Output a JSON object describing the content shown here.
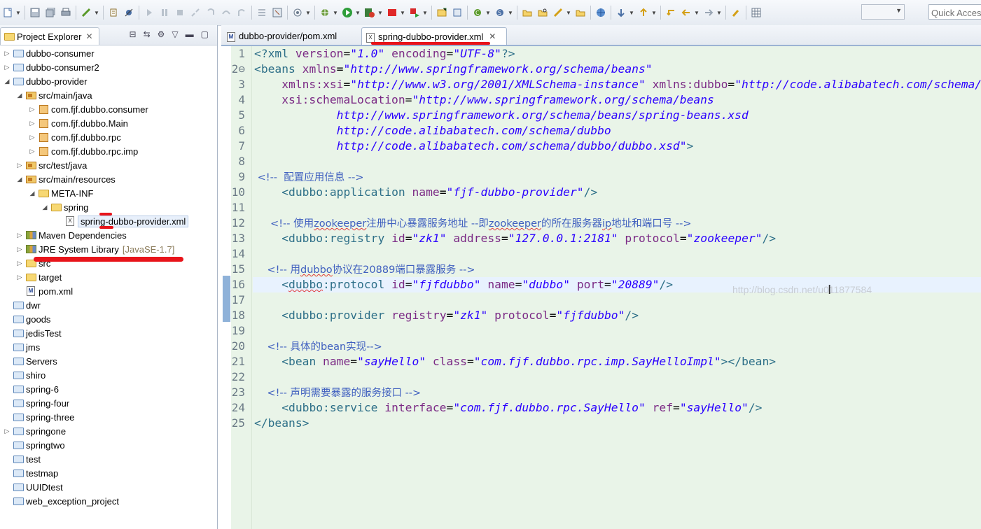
{
  "toolbar": {
    "quick_access_placeholder": "Quick Access",
    "icons": [
      "new-icon",
      "save-icon",
      "save-all-icon",
      "print-icon",
      "build-icon",
      "debug-icon",
      "skip-breakpoints-icon",
      "resume-icon",
      "suspend-icon",
      "terminate-icon",
      "disconnect-icon",
      "step-into-icon",
      "step-over-icon",
      "step-return-icon",
      "drop-to-frame-icon",
      "use-step-filters-icon",
      "open-perspective-icon",
      "external-tools-icon",
      "run-icon",
      "run-server-icon",
      "stop-icon",
      "coverage-icon",
      "new-java-project-icon",
      "new-package-icon",
      "new-class-icon",
      "open-type-icon",
      "open-task-icon",
      "search-icon",
      "web-browser-icon",
      "refresh-icon",
      "next-annotation-icon",
      "previous-annotation-icon",
      "last-edit-icon",
      "back-icon",
      "forward-icon",
      "pin-icon",
      "layout-icon"
    ]
  },
  "explorer": {
    "tab_title": "Project Explorer",
    "items": [
      {
        "label": "dubbo-consumer",
        "icon": "project"
      },
      {
        "label": "dubbo-consumer2",
        "icon": "project"
      },
      {
        "label": "dubbo-provider",
        "icon": "project"
      },
      {
        "label": "src/main/java",
        "icon": "source-folder"
      },
      {
        "label": "com.fjf.dubbo.consumer",
        "icon": "package"
      },
      {
        "label": "com.fjf.dubbo.Main",
        "icon": "package"
      },
      {
        "label": "com.fjf.dubbo.rpc",
        "icon": "package"
      },
      {
        "label": "com.fjf.dubbo.rpc.imp",
        "icon": "package"
      },
      {
        "label": "src/test/java",
        "icon": "source-folder"
      },
      {
        "label": "src/main/resources",
        "icon": "source-folder"
      },
      {
        "label": "META-INF",
        "icon": "folder"
      },
      {
        "label": "spring",
        "icon": "folder"
      },
      {
        "label": "spring-dubbo-provider.xml",
        "icon": "xml-file"
      },
      {
        "label": "Maven Dependencies",
        "icon": "library"
      },
      {
        "label": "JRE System Library",
        "icon": "library",
        "decoration": "[JavaSE-1.7]"
      },
      {
        "label": "src",
        "icon": "folder"
      },
      {
        "label": "target",
        "icon": "folder"
      },
      {
        "label": "pom.xml",
        "icon": "pom-file"
      },
      {
        "label": "dwr",
        "icon": "project"
      },
      {
        "label": "goods",
        "icon": "project"
      },
      {
        "label": "jedisTest",
        "icon": "project"
      },
      {
        "label": "jms",
        "icon": "project"
      },
      {
        "label": "Servers",
        "icon": "project"
      },
      {
        "label": "shiro",
        "icon": "project"
      },
      {
        "label": "spring-6",
        "icon": "project"
      },
      {
        "label": "spring-four",
        "icon": "project"
      },
      {
        "label": "spring-three",
        "icon": "project"
      },
      {
        "label": "springone",
        "icon": "project"
      },
      {
        "label": "springtwo",
        "icon": "project"
      },
      {
        "label": "test",
        "icon": "project"
      },
      {
        "label": "testmap",
        "icon": "project"
      },
      {
        "label": "UUIDtest",
        "icon": "project"
      },
      {
        "label": "web_exception_project",
        "icon": "project"
      }
    ]
  },
  "editor": {
    "tabs": [
      {
        "label": "dubbo-provider/pom.xml",
        "active": false
      },
      {
        "label": "spring-dubbo-provider.xml",
        "active": true
      }
    ],
    "watermark": "http://blog.csdn.net/u011877584",
    "lines": [
      {
        "n": "1",
        "tokens": [
          [
            "pun",
            "<?"
          ],
          [
            "tag",
            "xml "
          ],
          [
            "attr",
            "version"
          ],
          [
            "plain",
            "="
          ],
          [
            "str",
            "\"1.0\""
          ],
          [
            "plain",
            " "
          ],
          [
            "attr",
            "encoding"
          ],
          [
            "plain",
            "="
          ],
          [
            "str",
            "\"UTF-8\""
          ],
          [
            "pun",
            "?>"
          ]
        ]
      },
      {
        "n": "2⊖",
        "tokens": [
          [
            "pun",
            "<"
          ],
          [
            "tag",
            "beans "
          ],
          [
            "attr",
            "xmlns"
          ],
          [
            "plain",
            "="
          ],
          [
            "str",
            "\"http://www.springframework.org/schema/beans\""
          ]
        ]
      },
      {
        "n": "3",
        "tokens": [
          [
            "plain",
            "    "
          ],
          [
            "attr",
            "xmlns:xsi"
          ],
          [
            "plain",
            "="
          ],
          [
            "str",
            "\"http://www.w3.org/2001/XMLSchema-instance\""
          ],
          [
            "plain",
            " "
          ],
          [
            "attr",
            "xmlns:dubbo"
          ],
          [
            "plain",
            "="
          ],
          [
            "str",
            "\"http://code.alibabatech.com/schema/dubbo\""
          ]
        ]
      },
      {
        "n": "4",
        "tokens": [
          [
            "plain",
            "    "
          ],
          [
            "attr",
            "xsi:schemaLocation"
          ],
          [
            "plain",
            "="
          ],
          [
            "str",
            "\"http://www.springframework.org/schema/beans"
          ]
        ]
      },
      {
        "n": "5",
        "tokens": [
          [
            "str",
            "            http://www.springframework.org/schema/beans/spring-beans.xsd"
          ]
        ]
      },
      {
        "n": "6",
        "tokens": [
          [
            "str",
            "            http://code.alibabatech.com/schema/dubbo"
          ]
        ]
      },
      {
        "n": "7",
        "tokens": [
          [
            "str",
            "            http://code.alibabatech.com/schema/dubbo/dubbo.xsd\""
          ],
          [
            "pun",
            ">"
          ]
        ]
      },
      {
        "n": "8",
        "tokens": []
      },
      {
        "n": "9",
        "tokens": [
          [
            "com",
            " <!--  配置应用信息 -->"
          ]
        ]
      },
      {
        "n": "10",
        "tokens": [
          [
            "plain",
            "    "
          ],
          [
            "pun",
            "<"
          ],
          [
            "tag",
            "dubbo:application "
          ],
          [
            "attr",
            "name"
          ],
          [
            "plain",
            "="
          ],
          [
            "str",
            "\"fjf-dubbo-provider\""
          ],
          [
            "pun",
            "/>"
          ]
        ]
      },
      {
        "n": "11",
        "tokens": []
      },
      {
        "n": "12",
        "tokens": [
          [
            "com",
            "     <!-- 使用zookeeper注册中心暴露服务地址 --即zookeeper的所在服务器ip地址和端口号 -->"
          ]
        ]
      },
      {
        "n": "13",
        "tokens": [
          [
            "plain",
            "    "
          ],
          [
            "pun",
            "<"
          ],
          [
            "tag",
            "dubbo:registry "
          ],
          [
            "attr",
            "id"
          ],
          [
            "plain",
            "="
          ],
          [
            "str",
            "\"zk1\""
          ],
          [
            "plain",
            " "
          ],
          [
            "attr",
            "address"
          ],
          [
            "plain",
            "="
          ],
          [
            "str",
            "\"127.0.0.1:2181\""
          ],
          [
            "plain",
            " "
          ],
          [
            "attr",
            "protocol"
          ],
          [
            "plain",
            "="
          ],
          [
            "str",
            "\"zookeeper\""
          ],
          [
            "pun",
            "/>"
          ]
        ]
      },
      {
        "n": "14",
        "tokens": []
      },
      {
        "n": "15",
        "tokens": [
          [
            "com",
            "    <!-- 用dubbo协议在20889端口暴露服务 -->"
          ]
        ]
      },
      {
        "n": "16",
        "tokens": [
          [
            "plain",
            "    "
          ],
          [
            "pun",
            "<"
          ],
          [
            "tag",
            "dubbo:protocol "
          ],
          [
            "attr",
            "id"
          ],
          [
            "plain",
            "="
          ],
          [
            "str",
            "\"fjfdubbo\""
          ],
          [
            "plain",
            " "
          ],
          [
            "attr",
            "name"
          ],
          [
            "plain",
            "="
          ],
          [
            "str",
            "\"dubbo\""
          ],
          [
            "plain",
            " "
          ],
          [
            "attr",
            "port"
          ],
          [
            "plain",
            "="
          ],
          [
            "str",
            "\"20889\""
          ],
          [
            "pun",
            "/>"
          ]
        ]
      },
      {
        "n": "17",
        "tokens": []
      },
      {
        "n": "18",
        "tokens": [
          [
            "plain",
            "    "
          ],
          [
            "pun",
            "<"
          ],
          [
            "tag",
            "dubbo:provider "
          ],
          [
            "attr",
            "registry"
          ],
          [
            "plain",
            "="
          ],
          [
            "str",
            "\"zk1\""
          ],
          [
            "plain",
            " "
          ],
          [
            "attr",
            "protocol"
          ],
          [
            "plain",
            "="
          ],
          [
            "str",
            "\"fjfdubbo\""
          ],
          [
            "pun",
            "/>"
          ]
        ]
      },
      {
        "n": "19",
        "tokens": []
      },
      {
        "n": "20",
        "tokens": [
          [
            "com",
            "    <!-- 具体的bean实现-->"
          ]
        ]
      },
      {
        "n": "21",
        "tokens": [
          [
            "plain",
            "    "
          ],
          [
            "pun",
            "<"
          ],
          [
            "tag",
            "bean "
          ],
          [
            "attr",
            "name"
          ],
          [
            "plain",
            "="
          ],
          [
            "str",
            "\"sayHello\""
          ],
          [
            "plain",
            " "
          ],
          [
            "attr",
            "class"
          ],
          [
            "plain",
            "="
          ],
          [
            "str",
            "\"com.fjf.dubbo.rpc.imp.SayHelloImpl\""
          ],
          [
            "pun",
            "></"
          ],
          [
            "tag",
            "bean"
          ],
          [
            "pun",
            ">"
          ]
        ]
      },
      {
        "n": "22",
        "tokens": []
      },
      {
        "n": "23",
        "tokens": [
          [
            "com",
            "    <!-- 声明需要暴露的服务接口 -->"
          ]
        ]
      },
      {
        "n": "24",
        "tokens": [
          [
            "plain",
            "    "
          ],
          [
            "pun",
            "<"
          ],
          [
            "tag",
            "dubbo:service "
          ],
          [
            "attr",
            "interface"
          ],
          [
            "plain",
            "="
          ],
          [
            "str",
            "\"com.fjf.dubbo.rpc.SayHello\""
          ],
          [
            "plain",
            " "
          ],
          [
            "attr",
            "ref"
          ],
          [
            "plain",
            "="
          ],
          [
            "str",
            "\"sayHello\""
          ],
          [
            "pun",
            "/>"
          ]
        ]
      },
      {
        "n": "25",
        "tokens": [
          [
            "pun",
            "</"
          ],
          [
            "tag",
            "beans"
          ],
          [
            "pun",
            ">"
          ]
        ]
      }
    ]
  }
}
